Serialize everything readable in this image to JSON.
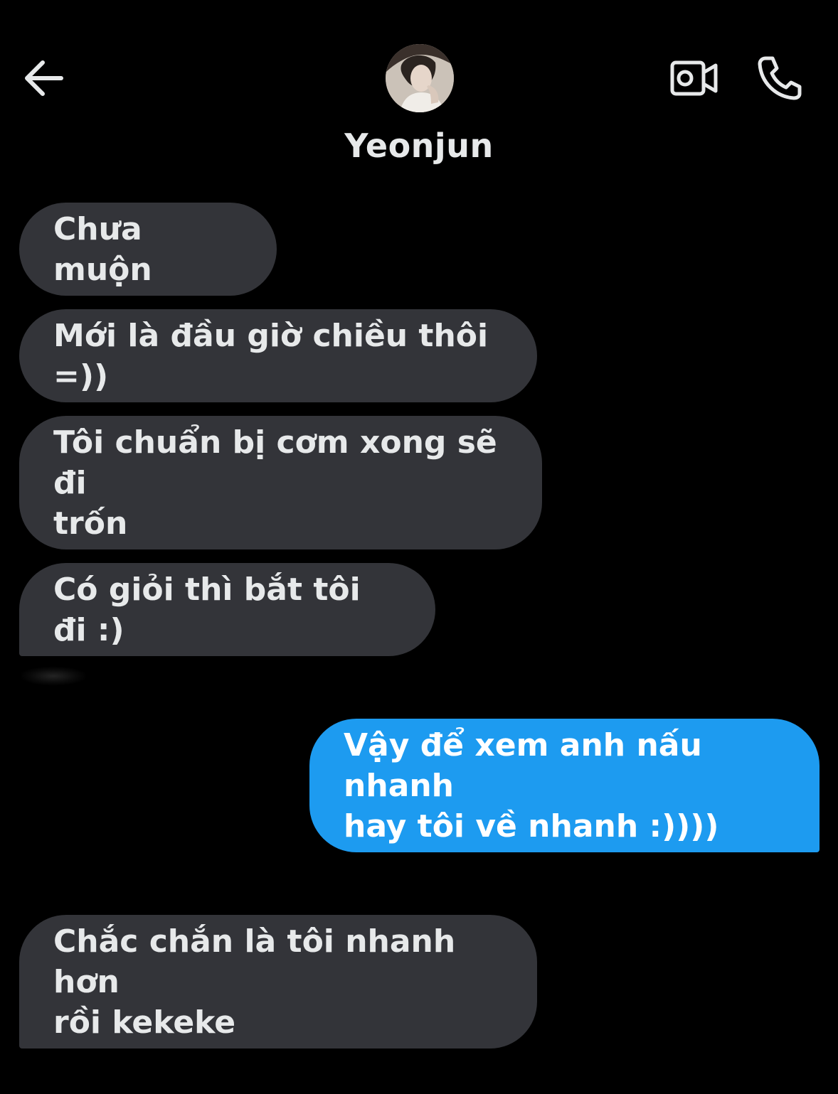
{
  "header": {
    "contact_name": "Yeonjun",
    "back_icon": "arrow-left-icon",
    "video_call_icon": "video-camera-icon",
    "voice_call_icon": "phone-icon"
  },
  "colors": {
    "background": "#000000",
    "incoming_bubble": "#333439",
    "outgoing_bubble": "#1d9bf0",
    "text": "#e7e9ea"
  },
  "messages": [
    {
      "direction": "incoming",
      "text": "Chưa muộn"
    },
    {
      "direction": "incoming",
      "text": "Mới là đầu giờ chiều thôi =))"
    },
    {
      "direction": "incoming",
      "text": "Tôi chuẩn bị cơm xong sẽ đi\ntrốn"
    },
    {
      "direction": "incoming",
      "text": "Có giỏi thì bắt tôi đi :)"
    },
    {
      "direction": "outgoing",
      "text": "Vậy để xem anh nấu nhanh\nhay tôi về nhanh :))))"
    },
    {
      "direction": "incoming",
      "text": "Chắc chắn là tôi nhanh hơn\nrồi kekeke"
    }
  ]
}
